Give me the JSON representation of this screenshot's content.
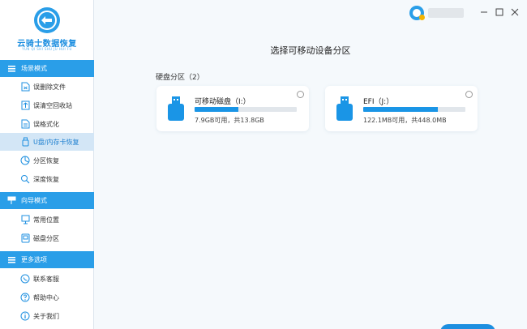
{
  "app": {
    "logo_name": "云骑士数据恢复",
    "logo_sub": "YUN QI SHI SHU JU HUI FU"
  },
  "sidebar": {
    "sections": [
      {
        "title": "场景模式",
        "items": [
          {
            "label": "误删除文件",
            "icon": "file-delete-icon"
          },
          {
            "label": "误清空回收站",
            "icon": "recycle-bin-icon"
          },
          {
            "label": "误格式化",
            "icon": "format-icon"
          },
          {
            "label": "U盘/内存卡恢复",
            "icon": "usb-card-icon",
            "active": true
          },
          {
            "label": "分区恢复",
            "icon": "partition-icon"
          },
          {
            "label": "深度恢复",
            "icon": "deep-scan-icon"
          }
        ]
      },
      {
        "title": "向导模式",
        "items": [
          {
            "label": "常用位置",
            "icon": "location-icon"
          },
          {
            "label": "磁盘分区",
            "icon": "disk-icon"
          }
        ]
      },
      {
        "title": "更多选项",
        "items": [
          {
            "label": "联系客服",
            "icon": "headset-icon"
          },
          {
            "label": "帮助中心",
            "icon": "help-icon"
          },
          {
            "label": "关于我们",
            "icon": "info-icon"
          }
        ]
      }
    ]
  },
  "main": {
    "title": "选择可移动设备分区",
    "partition_header": "硬盘分区（2）",
    "drives": [
      {
        "name": "可移动磁盘（I:）",
        "size_text": "7.9GB可用，共13.8GB",
        "used_fraction": 0.43
      },
      {
        "name": "EFI（J:）",
        "size_text": "122.1MB可用，共448.0MB",
        "used_fraction": 0.73
      }
    ]
  },
  "colors": {
    "accent": "#2a9ee8",
    "active_bg": "#d3e6f6",
    "bar_fill": "#1a95e6",
    "bar_track": "#e1e6eb"
  }
}
